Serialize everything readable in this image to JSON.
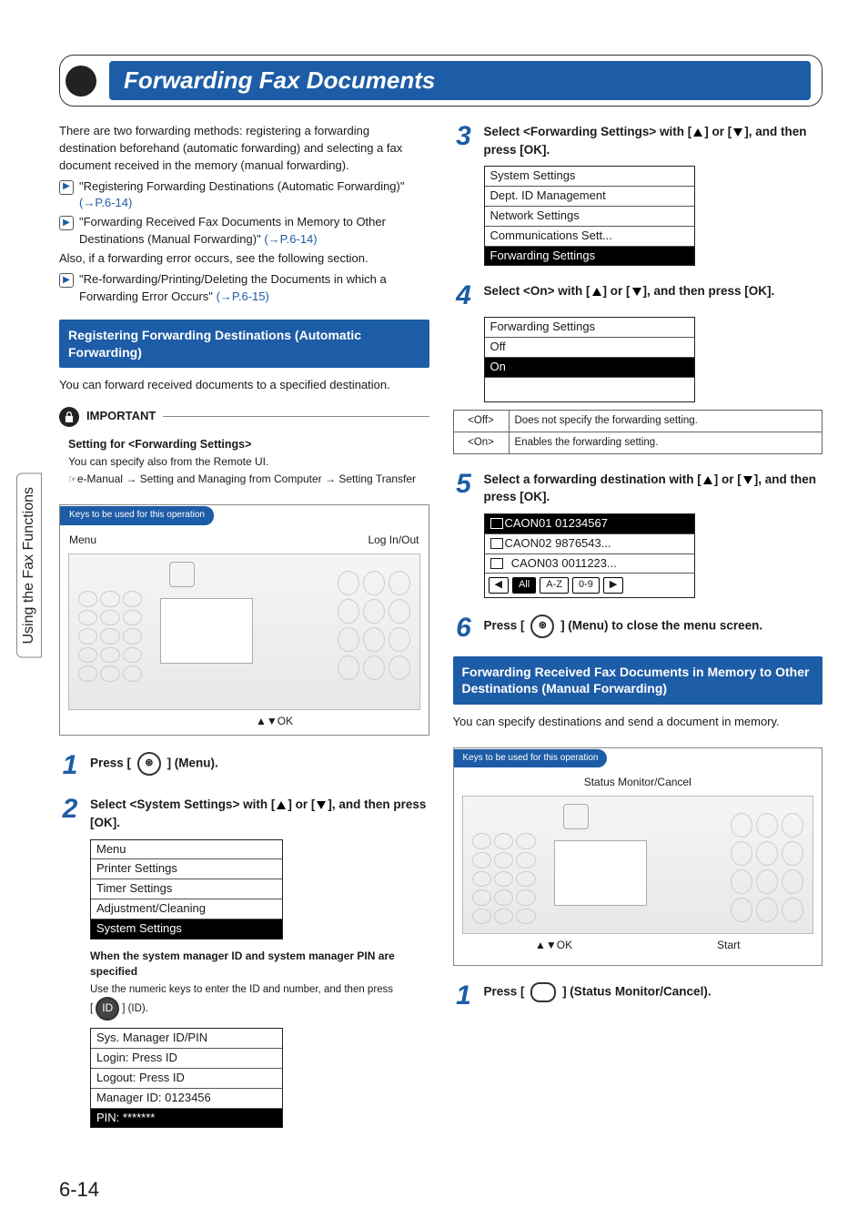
{
  "page_number": "6-14",
  "side_tab": "Using the Fax Functions",
  "title": "Forwarding Fax Documents",
  "intro": "There are two forwarding methods: registering a forwarding destination beforehand (automatic forwarding) and selecting a fax document received in the memory (manual forwarding).",
  "xrefs": [
    {
      "text": "\"Registering Forwarding Destinations (Automatic Forwarding)\"",
      "page": "(→P.6-14)"
    },
    {
      "text": "\"Forwarding Received Fax Documents in Memory to Other Destinations (Manual Forwarding)\"",
      "page": "(→P.6-14)"
    }
  ],
  "also_line": "Also, if a forwarding error occurs, see the following section.",
  "xref3": {
    "text": "\"Re-forwarding/Printing/Deleting the Documents in which a Forwarding Error Occurs\"",
    "page": "(→P.6-15)"
  },
  "subhead1": "Registering Forwarding Destinations (Automatic Forwarding)",
  "sub1_body": "You can forward received documents to a specified destination.",
  "important_label": "IMPORTANT",
  "setting_heading": "Setting for <Forwarding Settings>",
  "setting_body": "You can specify also from the Remote UI.",
  "crumbs": "e-Manual → Setting and Managing from Computer → Setting Transfer",
  "keys_label": "Keys to be used for this operation",
  "panel_labels": {
    "menu": "Menu",
    "loginout": "Log In/Out",
    "ok": "▲▼OK",
    "status": "Status Monitor/Cancel",
    "start": "Start"
  },
  "steps_left": {
    "s1": "Press [",
    "s1_tail": "] (Menu).",
    "s2_a": "Select <System Settings> with [",
    "s2_b": "] or [",
    "s2_c": "], and then press [OK].",
    "menu_lcd": [
      "Menu",
      "Printer Settings",
      "Timer Settings",
      "Adjustment/Cleaning",
      "System Settings"
    ],
    "note_h": "When the system manager ID and system manager PIN are specified",
    "note_b1": "Use the numeric keys to enter the ID and number, and then press",
    "note_b2": "[",
    "note_b3": "] (ID).",
    "id_lcd": [
      "Sys. Manager ID/PIN",
      "Login: Press ID",
      "Logout: Press ID",
      " Manager ID: 0123456",
      "PIN: *******"
    ]
  },
  "steps_right": {
    "s3_a": "Select <Forwarding Settings> with [",
    "s3_b": "] or [",
    "s3_c": "], and then press [OK].",
    "lcd3": [
      "System Settings",
      "Dept. ID Management",
      "Network Settings",
      "Communications Sett...",
      "Forwarding Settings"
    ],
    "s4_a": "Select <On> with [",
    "s4_b": "] or [",
    "s4_c": "], and then press [OK].",
    "lcd4": [
      "Forwarding Settings",
      "Off",
      "On"
    ],
    "table": {
      "off_l": "<Off>",
      "off_v": "Does not specify the forwarding setting.",
      "on_l": "<On>",
      "on_v": "Enables the forwarding setting."
    },
    "s5_a": "Select a forwarding destination with [",
    "s5_b": "] or [",
    "s5_c": "], and then press [OK].",
    "lcd5_rows": [
      "CAON01 01234567",
      "CAON02 9876543...",
      "CAON03 0011223..."
    ],
    "lcd5_btns": [
      "All",
      "A-Z",
      "0-9",
      "▶"
    ],
    "s6_a": "Press [",
    "s6_b": "] (Menu) to close the menu screen."
  },
  "subhead2": "Forwarding Received Fax Documents in Memory to Other Destinations (Manual Forwarding)",
  "manual_body": "You can specify destinations and send a document in memory.",
  "steps_manual": {
    "s1_a": "Press [",
    "s1_b": "] (Status Monitor/Cancel)."
  }
}
